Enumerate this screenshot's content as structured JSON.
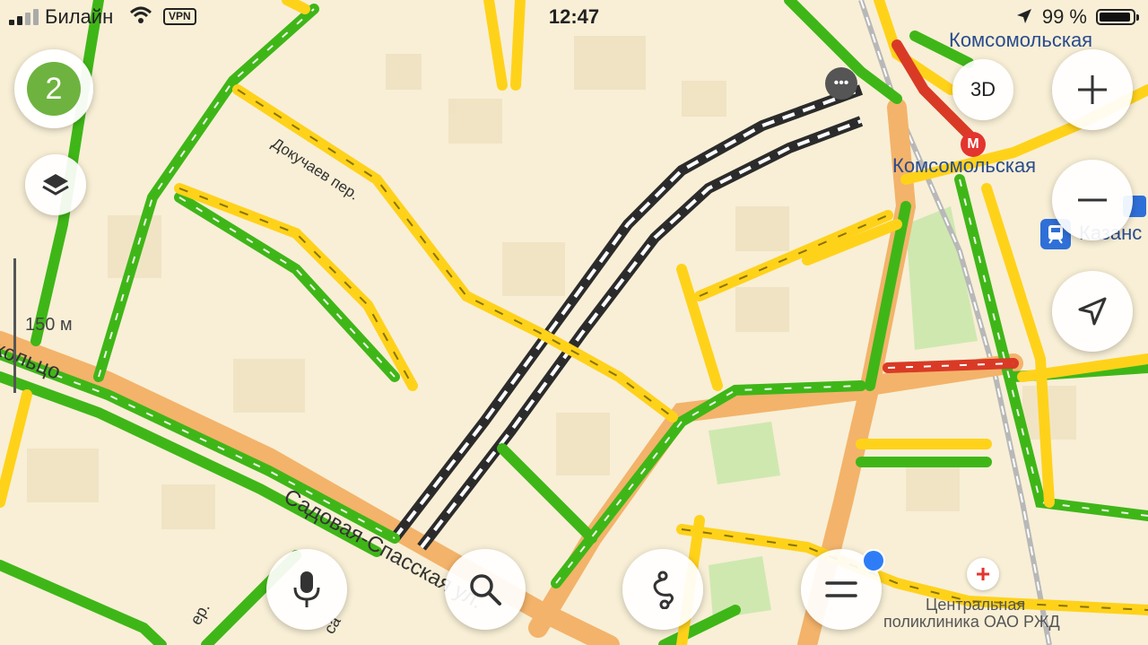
{
  "status_bar": {
    "carrier": "Билайн",
    "vpn": "VPN",
    "time": "12:47",
    "battery": "99 %",
    "battery_level": 0.99
  },
  "controls": {
    "traffic_score": "2",
    "btn_3d": "3D",
    "scale": "150 м"
  },
  "labels": {
    "komsomolskaya_square": "Комсомольская",
    "komsomolskaya_metro": "Комсомольская",
    "kazan_station": "Казанс",
    "dokuchaev": "Докучаев пер.",
    "ring": "кольцо",
    "sadovaya": "Садовая-Спасская ул.",
    "clinic_line1": "Центральная",
    "clinic_line2": "поликлиника ОАО РЖД",
    "lane_fragment_1": "ер.",
    "lane_fragment_2": "са"
  },
  "colors": {
    "background": "#f8efd6",
    "free": "#3fb618",
    "slow": "#ffd21a",
    "jam": "#d93a26",
    "major_road": "#f3b36a",
    "tunnel": "#2b2b2b",
    "accent": "#2f7df6"
  },
  "icons": [
    "microphone-icon",
    "search-icon",
    "route-icon",
    "menu-icon",
    "plus-icon",
    "minus-icon",
    "navigation-arrow-icon",
    "layers-icon",
    "metro-icon",
    "train-icon",
    "hospital-icon",
    "chat-icon"
  ]
}
